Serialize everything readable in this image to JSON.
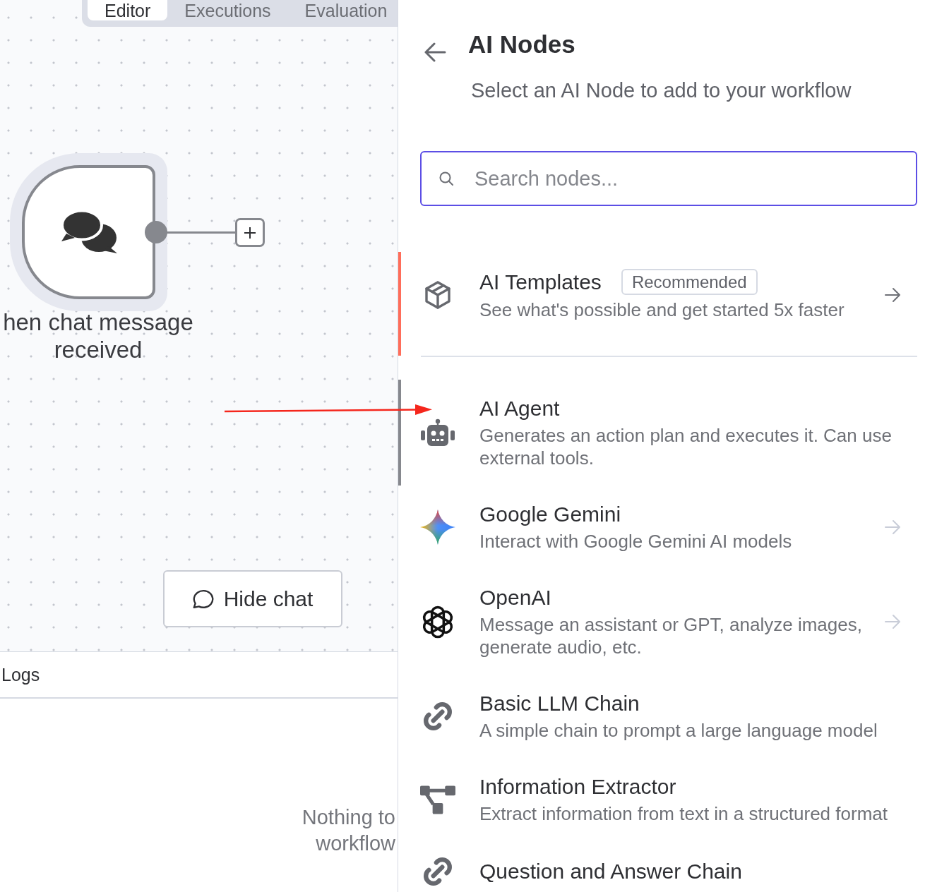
{
  "canvas": {
    "tabs": [
      {
        "label": "Editor",
        "selected": true
      },
      {
        "label": "Executions",
        "selected": false
      },
      {
        "label": "Evaluation",
        "selected": false
      }
    ],
    "trigger_node": {
      "label": "hen chat message received"
    },
    "hide_chat_button": {
      "label": "Hide chat"
    }
  },
  "logs": {
    "title": "Logs",
    "empty_message_lines": [
      "Nothing to",
      "workflow"
    ]
  },
  "annotations": [
    {
      "kind": "arrow"
    }
  ],
  "panel": {
    "title": "AI Nodes",
    "subtitle": "Select an AI Node to add to your workflow",
    "search": {
      "placeholder": "Search nodes..."
    },
    "featured": {
      "title": "AI Templates",
      "badge": "Recommended",
      "description": "See what's possible and get started 5x faster",
      "highlighted": true,
      "submenu": true
    },
    "nodes": [
      {
        "title": "AI Agent",
        "description": "Generates an action plan and executes it. Can use external tools.",
        "selected": true,
        "submenu": false
      },
      {
        "title": "Google Gemini",
        "description": "Interact with Google Gemini AI models",
        "selected": false,
        "submenu": true
      },
      {
        "title": "OpenAI",
        "description": "Message an assistant or GPT, analyze images, generate audio, etc.",
        "selected": false,
        "submenu": true
      },
      {
        "title": "Basic LLM Chain",
        "description": "A simple chain to prompt a large language model",
        "selected": false,
        "submenu": false
      },
      {
        "title": "Information Extractor",
        "description": "Extract information from text in a structured format",
        "selected": false,
        "submenu": false
      },
      {
        "title": "Question and Answer Chain",
        "selected": false,
        "submenu": false
      }
    ]
  }
}
